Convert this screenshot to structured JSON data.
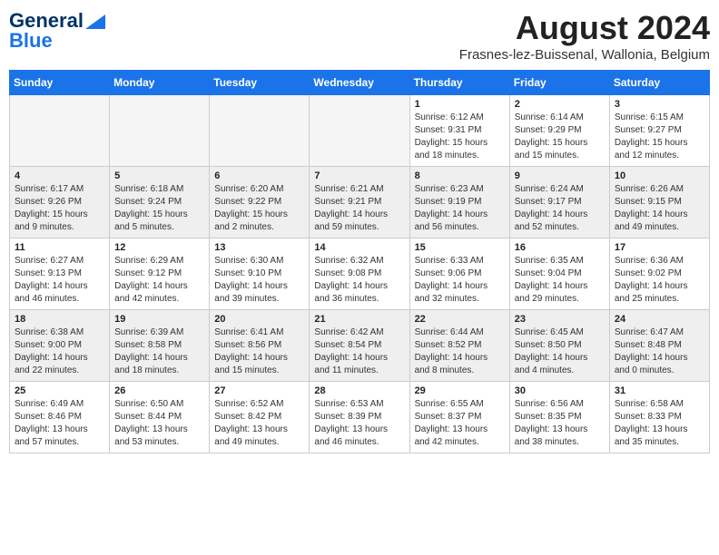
{
  "header": {
    "logo_line1": "General",
    "logo_line2": "Blue",
    "title": "August 2024",
    "location": "Frasnes-lez-Buissenal, Wallonia, Belgium"
  },
  "days_of_week": [
    "Sunday",
    "Monday",
    "Tuesday",
    "Wednesday",
    "Thursday",
    "Friday",
    "Saturday"
  ],
  "weeks": [
    [
      {
        "day": "",
        "empty": true
      },
      {
        "day": "",
        "empty": true
      },
      {
        "day": "",
        "empty": true
      },
      {
        "day": "",
        "empty": true
      },
      {
        "day": "1",
        "sunrise": "6:12 AM",
        "sunset": "9:31 PM",
        "daylight": "15 hours and 18 minutes."
      },
      {
        "day": "2",
        "sunrise": "6:14 AM",
        "sunset": "9:29 PM",
        "daylight": "15 hours and 15 minutes."
      },
      {
        "day": "3",
        "sunrise": "6:15 AM",
        "sunset": "9:27 PM",
        "daylight": "15 hours and 12 minutes."
      }
    ],
    [
      {
        "day": "4",
        "sunrise": "6:17 AM",
        "sunset": "9:26 PM",
        "daylight": "15 hours and 9 minutes."
      },
      {
        "day": "5",
        "sunrise": "6:18 AM",
        "sunset": "9:24 PM",
        "daylight": "15 hours and 5 minutes."
      },
      {
        "day": "6",
        "sunrise": "6:20 AM",
        "sunset": "9:22 PM",
        "daylight": "15 hours and 2 minutes."
      },
      {
        "day": "7",
        "sunrise": "6:21 AM",
        "sunset": "9:21 PM",
        "daylight": "14 hours and 59 minutes."
      },
      {
        "day": "8",
        "sunrise": "6:23 AM",
        "sunset": "9:19 PM",
        "daylight": "14 hours and 56 minutes."
      },
      {
        "day": "9",
        "sunrise": "6:24 AM",
        "sunset": "9:17 PM",
        "daylight": "14 hours and 52 minutes."
      },
      {
        "day": "10",
        "sunrise": "6:26 AM",
        "sunset": "9:15 PM",
        "daylight": "14 hours and 49 minutes."
      }
    ],
    [
      {
        "day": "11",
        "sunrise": "6:27 AM",
        "sunset": "9:13 PM",
        "daylight": "14 hours and 46 minutes."
      },
      {
        "day": "12",
        "sunrise": "6:29 AM",
        "sunset": "9:12 PM",
        "daylight": "14 hours and 42 minutes."
      },
      {
        "day": "13",
        "sunrise": "6:30 AM",
        "sunset": "9:10 PM",
        "daylight": "14 hours and 39 minutes."
      },
      {
        "day": "14",
        "sunrise": "6:32 AM",
        "sunset": "9:08 PM",
        "daylight": "14 hours and 36 minutes."
      },
      {
        "day": "15",
        "sunrise": "6:33 AM",
        "sunset": "9:06 PM",
        "daylight": "14 hours and 32 minutes."
      },
      {
        "day": "16",
        "sunrise": "6:35 AM",
        "sunset": "9:04 PM",
        "daylight": "14 hours and 29 minutes."
      },
      {
        "day": "17",
        "sunrise": "6:36 AM",
        "sunset": "9:02 PM",
        "daylight": "14 hours and 25 minutes."
      }
    ],
    [
      {
        "day": "18",
        "sunrise": "6:38 AM",
        "sunset": "9:00 PM",
        "daylight": "14 hours and 22 minutes."
      },
      {
        "day": "19",
        "sunrise": "6:39 AM",
        "sunset": "8:58 PM",
        "daylight": "14 hours and 18 minutes."
      },
      {
        "day": "20",
        "sunrise": "6:41 AM",
        "sunset": "8:56 PM",
        "daylight": "14 hours and 15 minutes."
      },
      {
        "day": "21",
        "sunrise": "6:42 AM",
        "sunset": "8:54 PM",
        "daylight": "14 hours and 11 minutes."
      },
      {
        "day": "22",
        "sunrise": "6:44 AM",
        "sunset": "8:52 PM",
        "daylight": "14 hours and 8 minutes."
      },
      {
        "day": "23",
        "sunrise": "6:45 AM",
        "sunset": "8:50 PM",
        "daylight": "14 hours and 4 minutes."
      },
      {
        "day": "24",
        "sunrise": "6:47 AM",
        "sunset": "8:48 PM",
        "daylight": "14 hours and 0 minutes."
      }
    ],
    [
      {
        "day": "25",
        "sunrise": "6:49 AM",
        "sunset": "8:46 PM",
        "daylight": "13 hours and 57 minutes."
      },
      {
        "day": "26",
        "sunrise": "6:50 AM",
        "sunset": "8:44 PM",
        "daylight": "13 hours and 53 minutes."
      },
      {
        "day": "27",
        "sunrise": "6:52 AM",
        "sunset": "8:42 PM",
        "daylight": "13 hours and 49 minutes."
      },
      {
        "day": "28",
        "sunrise": "6:53 AM",
        "sunset": "8:39 PM",
        "daylight": "13 hours and 46 minutes."
      },
      {
        "day": "29",
        "sunrise": "6:55 AM",
        "sunset": "8:37 PM",
        "daylight": "13 hours and 42 minutes."
      },
      {
        "day": "30",
        "sunrise": "6:56 AM",
        "sunset": "8:35 PM",
        "daylight": "13 hours and 38 minutes."
      },
      {
        "day": "31",
        "sunrise": "6:58 AM",
        "sunset": "8:33 PM",
        "daylight": "13 hours and 35 minutes."
      }
    ]
  ]
}
